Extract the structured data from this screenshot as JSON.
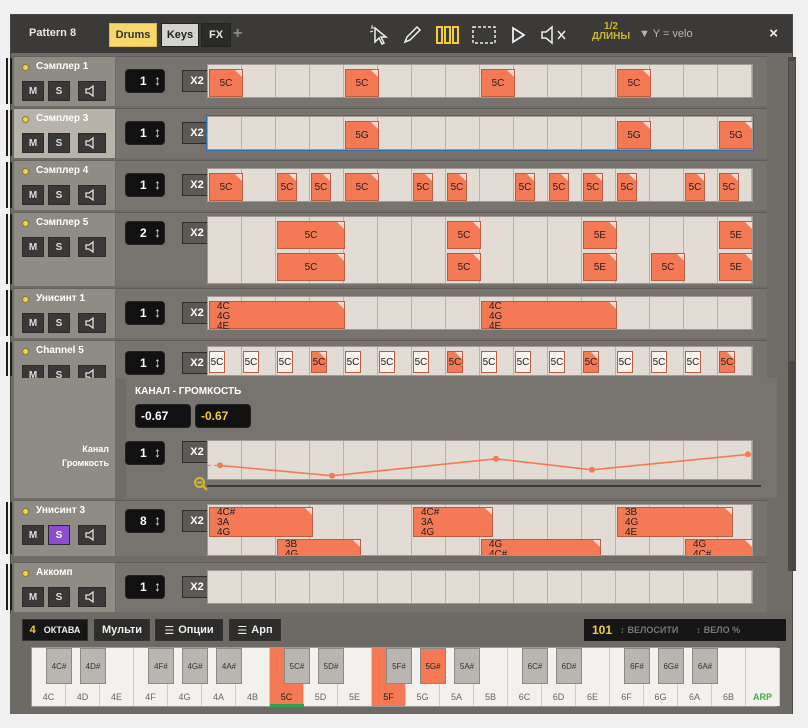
{
  "window": {
    "title": "Pattern 8",
    "tabs": [
      {
        "label": "Drums",
        "active": true
      },
      {
        "label": "Keys",
        "active": false
      },
      {
        "label": "FX",
        "active": false
      }
    ],
    "plus_label": "+",
    "close_label": "×",
    "toolbar": {
      "select_icon": "cursor-icon",
      "pencil_icon": "pencil-icon",
      "bars_icon": "bars-icon",
      "rect_select_icon": "dashed-rect-icon",
      "play_icon": "play-icon",
      "mute_icon": "mute-icon",
      "length_label": "1/2",
      "length_label_sub": "ДЛИНЫ",
      "y_label": "▼ Y = velo"
    }
  },
  "tracks": [
    {
      "name": "Сэмплер 1",
      "steps": "1",
      "x2": "X2",
      "m": "M",
      "s": "S"
    },
    {
      "name": "Сэмплер 3",
      "steps": "1",
      "x2": "X2",
      "m": "M",
      "s": "S"
    },
    {
      "name": "Сэмплер 4",
      "steps": "1",
      "x2": "X2",
      "m": "M",
      "s": "S"
    },
    {
      "name": "Сэмплер 5",
      "steps": "2",
      "x2": "X2",
      "m": "M",
      "s": "S"
    },
    {
      "name": "Унисинт 1",
      "steps": "1",
      "x2": "X2",
      "m": "M",
      "s": "S"
    },
    {
      "name": "Channel 5",
      "steps": "1",
      "x2": "X2",
      "m": "M",
      "s": "S"
    },
    {
      "name": "Унисинт 3",
      "steps": "8",
      "x2": "X2",
      "m": "M",
      "s": "S",
      "solo_on": true
    },
    {
      "name": "Аккомп",
      "steps": "1",
      "x2": "X2",
      "m": "M",
      "s": "S"
    }
  ],
  "automation": {
    "title": "КАНАЛ - ГРОМКОСТЬ",
    "value_left": "-0.67",
    "value_right": "-0.67",
    "label_line1": "Канал",
    "label_line2": "Громкость",
    "steps": "1",
    "x2": "X2",
    "zoom_icon": "zoom-out-icon",
    "points": [
      -0.2,
      -0.67,
      0.1,
      -0.4,
      0.3
    ]
  },
  "notes": {
    "t1": [
      "5C",
      "5C",
      "5C",
      "5C"
    ],
    "t2": [
      "5G",
      "5G",
      "5G"
    ],
    "t3": [
      "5C",
      "5C",
      "5C",
      "5C",
      "5C",
      "5C",
      "5C",
      "5C",
      "5C",
      "5C",
      "5C",
      "5C"
    ],
    "t4_top": [
      "5C",
      "5C",
      "5E",
      "5E"
    ],
    "t4_bot": [
      "5C",
      "5C",
      "5E",
      "5C",
      "5E"
    ],
    "t5": [
      "4C\n4G\n4E",
      "4C\n4G\n4E"
    ],
    "t6": [
      "5C",
      "5C",
      "5C",
      "5C",
      "5C",
      "5C",
      "5C",
      "5C",
      "5C",
      "5C",
      "5C",
      "5C",
      "5C",
      "5C",
      "5C",
      "5C"
    ],
    "t7_top": [
      "4C#\n3A\n4G",
      "4C#\n3A\n4G",
      "3B\n4G\n4E"
    ],
    "t7_bot": [
      "3B\n4G",
      "4G\n4C#",
      "4G\n4C#"
    ]
  },
  "bottom": {
    "octave_value": "4",
    "octave_label": "ОКТАВА",
    "multi_label": "Мульти",
    "options_label": "Опции",
    "arp_label": "Арп",
    "velocity_value": "101",
    "velocity_label": "ВЕЛОСИТИ",
    "velo_pct_label": "ВЕЛО %"
  },
  "keys": {
    "white": [
      "4C",
      "4D",
      "4E",
      "4F",
      "4G",
      "4A",
      "4B",
      "5C",
      "5D",
      "5E",
      "5F",
      "5G",
      "5A",
      "5B",
      "6C",
      "6D",
      "6E",
      "6F",
      "6G",
      "6A",
      "6B",
      "ARP"
    ],
    "black": [
      "4C#",
      "4D#",
      "4F#",
      "4G#",
      "4A#",
      "5C#",
      "5D#",
      "5F#",
      "5G#",
      "5A#",
      "6C#",
      "6D#",
      "6F#",
      "6G#",
      "6A#"
    ]
  },
  "colors": {
    "accent": "#f3ce39",
    "note": "#f47a55",
    "solo": "#8b4ed0"
  }
}
